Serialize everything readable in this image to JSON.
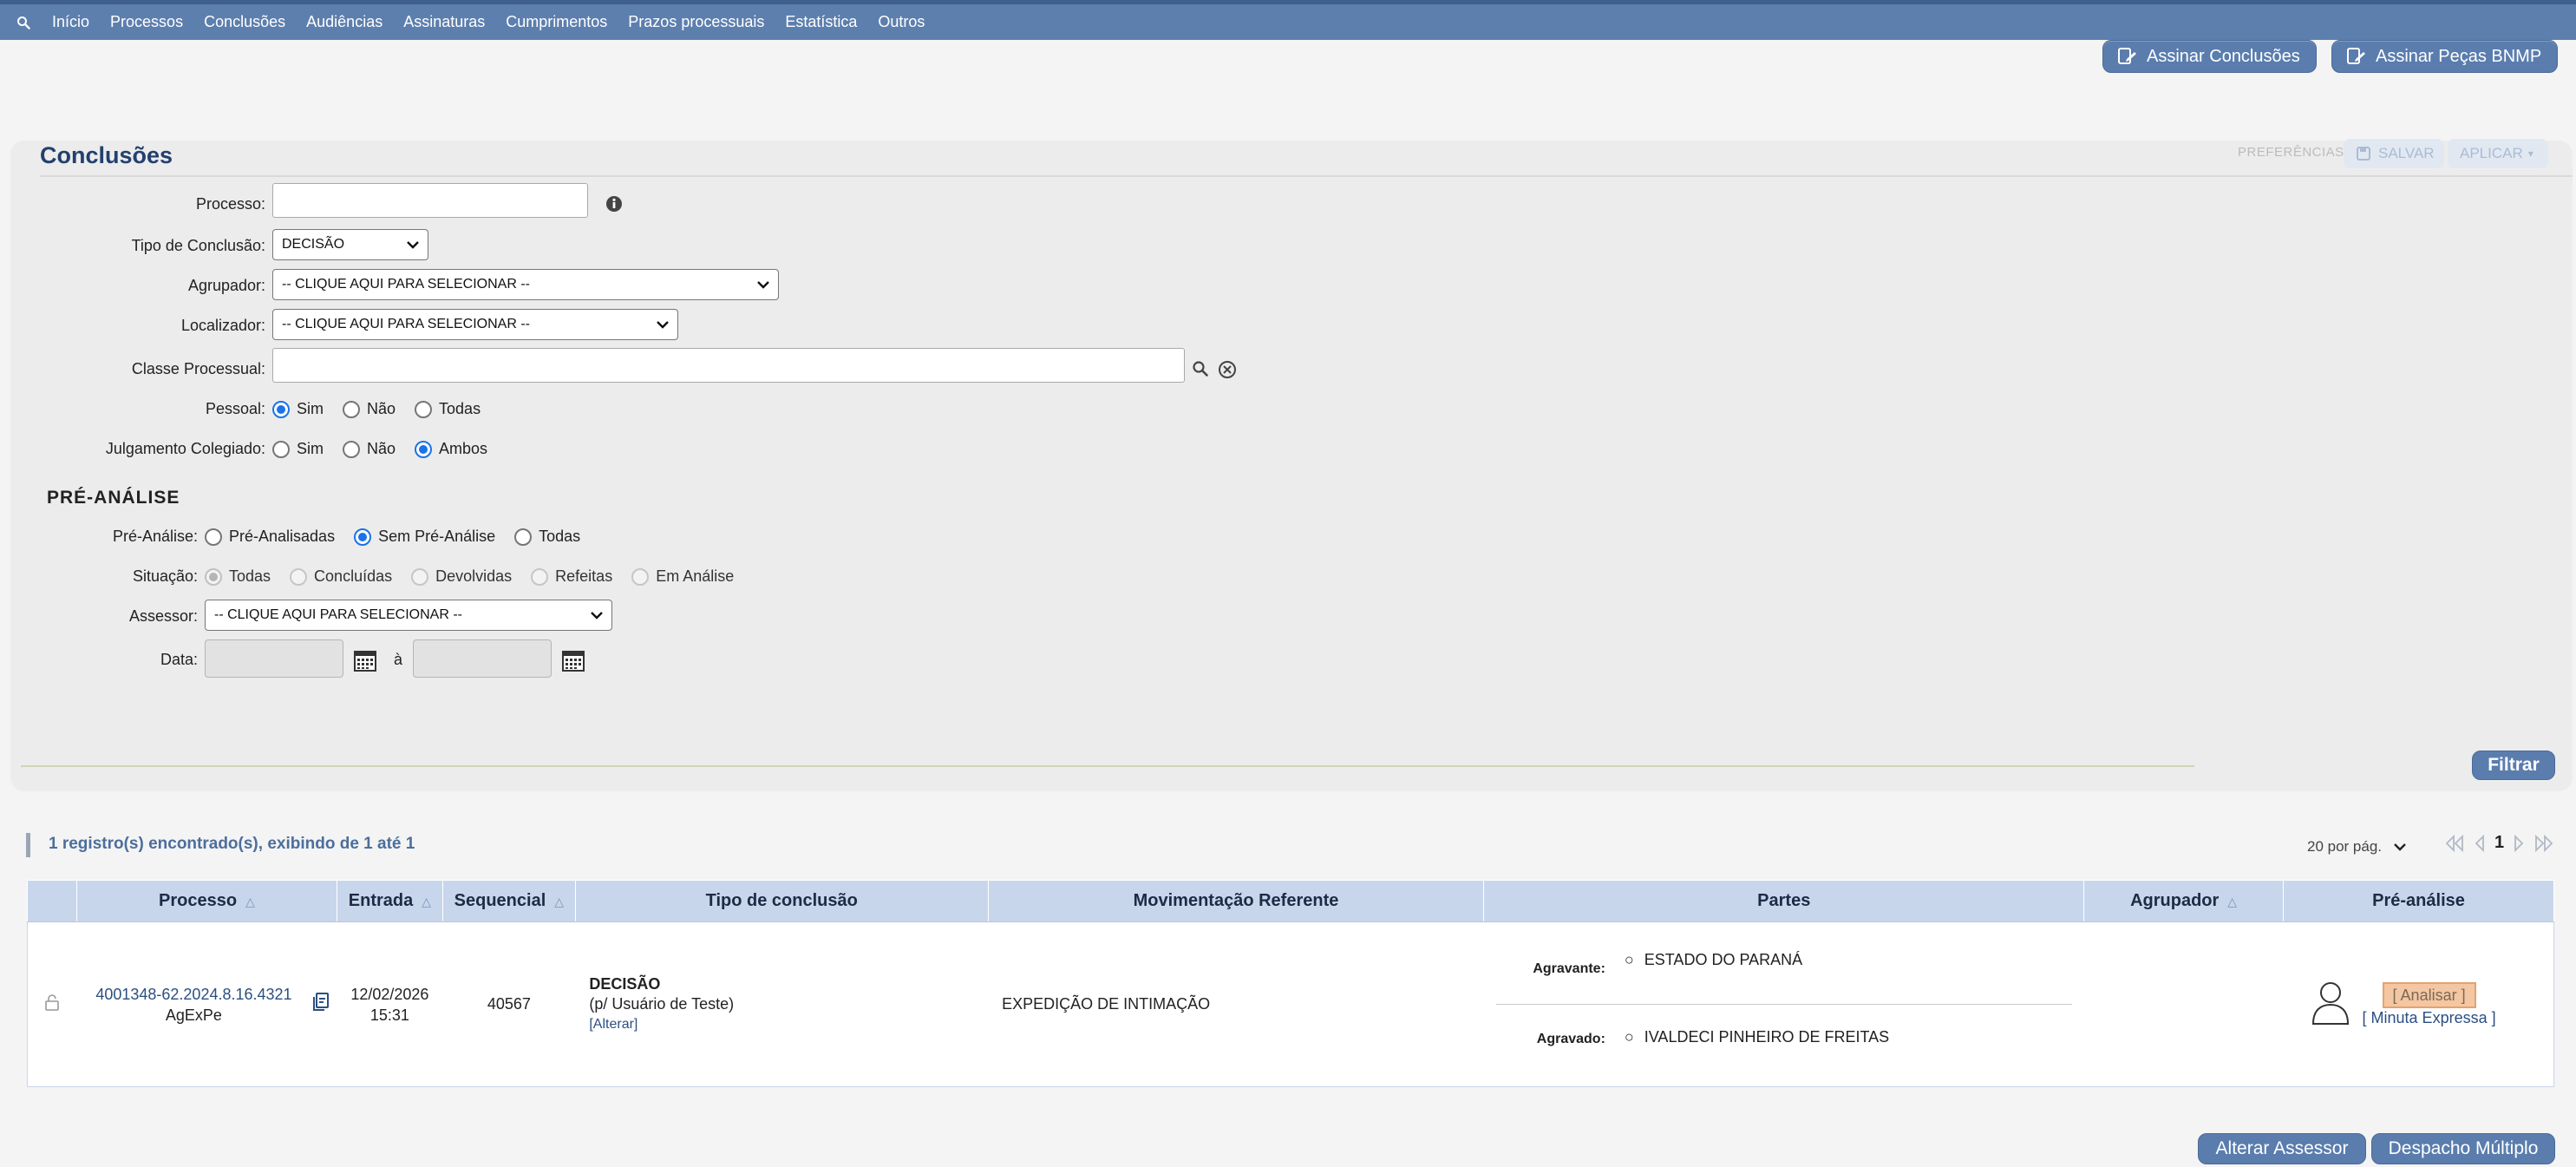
{
  "nav": {
    "items": [
      "Início",
      "Processos",
      "Conclusões",
      "Audiências",
      "Assinaturas",
      "Cumprimentos",
      "Prazos processuais",
      "Estatística",
      "Outros"
    ]
  },
  "header_buttons": {
    "sign_conclusions": "Assinar Conclusões",
    "sign_bnmp": "Assinar Peças BNMP"
  },
  "panel": {
    "title": "Conclusões",
    "preferences_label": "PREFERÊNCIAS",
    "save_label": "SALVAR",
    "apply_label": "APLICAR"
  },
  "form": {
    "processo_label": "Processo:",
    "processo_value": "",
    "tipo_label": "Tipo de Conclusão:",
    "tipo_value": "DECISÃO",
    "agrupador_label": "Agrupador:",
    "agrupador_value": "-- CLIQUE AQUI PARA SELECIONAR --",
    "localizador_label": "Localizador:",
    "localizador_value": "-- CLIQUE AQUI PARA SELECIONAR --",
    "classe_label": "Classe Processual:",
    "classe_value": "",
    "pessoal_label": "Pessoal:",
    "pessoal_options": [
      "Sim",
      "Não",
      "Todas"
    ],
    "pessoal_selected": 0,
    "julgamento_label": "Julgamento Colegiado:",
    "julgamento_options": [
      "Sim",
      "Não",
      "Ambos"
    ],
    "julgamento_selected": 2
  },
  "pre_analise": {
    "section_title": "PRÉ-ANÁLISE",
    "pa_label": "Pré-Análise:",
    "pa_options": [
      "Pré-Analisadas",
      "Sem Pré-Análise",
      "Todas"
    ],
    "pa_selected": 1,
    "situacao_label": "Situação:",
    "situacao_options": [
      "Todas",
      "Concluídas",
      "Devolvidas",
      "Refeitas",
      "Em Análise"
    ],
    "situacao_selected": 0,
    "assessor_label": "Assessor:",
    "assessor_value": "-- CLIQUE AQUI PARA SELECIONAR --",
    "data_label": "Data:",
    "data_sep": "à"
  },
  "filter_button": "Filtrar",
  "results": {
    "summary": "1 registro(s) encontrado(s), exibindo de 1 até 1",
    "per_page": "20 por pág.",
    "current_page": "1"
  },
  "table": {
    "headers": {
      "processo": "Processo",
      "entrada": "Entrada",
      "sequencial": "Sequencial",
      "tipo": "Tipo de conclusão",
      "movimentacao": "Movimentação Referente",
      "partes": "Partes",
      "agrupador": "Agrupador",
      "pre_analise": "Pré-análise"
    },
    "row": {
      "processo_num": "4001348-62.2024.8.16.4321",
      "processo_sub": "AgExPe",
      "entrada_date": "12/02/2026",
      "entrada_time": "15:31",
      "sequencial": "40567",
      "tipo_title": "DECISÃO",
      "tipo_sub": "(p/ Usuário de Teste)",
      "tipo_link": "[Alterar]",
      "movimentacao": "EXPEDIÇÃO DE INTIMAÇÃO",
      "parte1_role": "Agravante:",
      "parte1_name": "ESTADO DO PARANÁ",
      "parte2_role": "Agravado:",
      "parte2_name": "IVALDECI PINHEIRO DE FREITAS",
      "agrupador": "",
      "analisar": "[ Analisar ]",
      "minuta": "[ Minuta Expressa ]"
    }
  },
  "bottom_buttons": {
    "alterar_assessor": "Alterar Assessor",
    "despacho_multiplo": "Despacho Múltiplo"
  },
  "colors": {
    "nav_bg": "#5d7fae",
    "button_bg": "#5a7dae",
    "table_header_bg": "#c8d6ec",
    "analisar_bg": "#f5c6a2",
    "title_color": "#23406e"
  }
}
